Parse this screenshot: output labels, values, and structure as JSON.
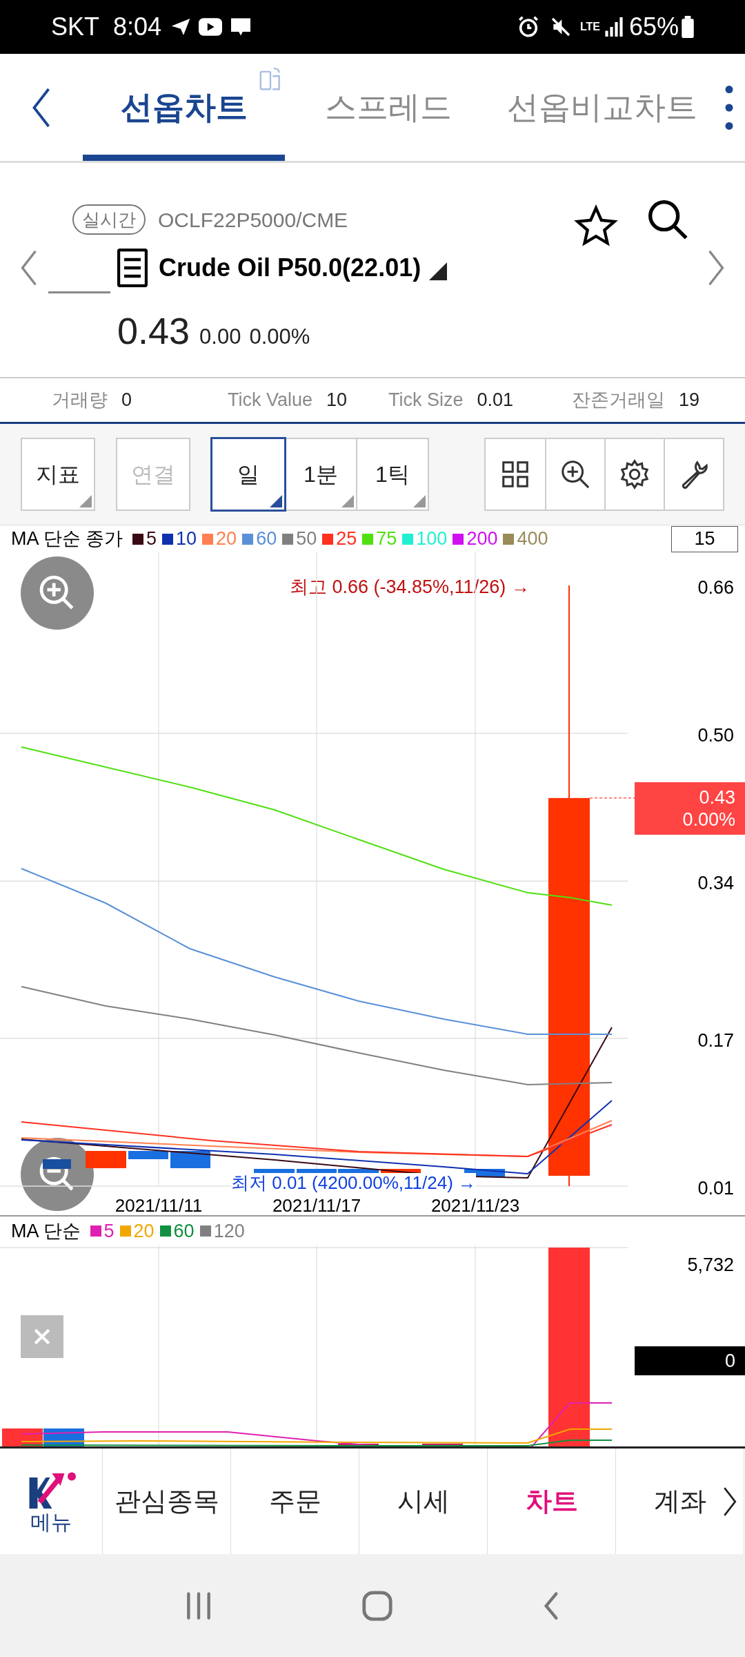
{
  "status_bar": {
    "carrier": "SKT",
    "time": "8:04",
    "network": "LTE",
    "battery": "65%"
  },
  "tabs": [
    {
      "label": "선옵차트",
      "selected": true
    },
    {
      "label": "스프레드",
      "selected": false
    },
    {
      "label": "선옵비교차트",
      "selected": false
    }
  ],
  "instrument": {
    "badge": "실시간",
    "code": "OCLF22P5000/CME",
    "name": "Crude Oil P50.0(22.01)",
    "price": "0.43",
    "change": "0.00",
    "change_pct": "0.00%"
  },
  "stats": [
    {
      "label": "거래량",
      "value": "0"
    },
    {
      "label": "Tick Value",
      "value": "10"
    },
    {
      "label": "Tick Size",
      "value": "0.01"
    },
    {
      "label": "잔존거래일",
      "value": "19"
    }
  ],
  "toolbar": [
    {
      "label": "지표",
      "selected": false,
      "disabled": false,
      "has_menu": true
    },
    {
      "label": "연결",
      "selected": false,
      "disabled": true,
      "has_menu": false
    },
    {
      "label": "일",
      "selected": true,
      "disabled": false,
      "has_menu": true
    },
    {
      "label": "1분",
      "selected": false,
      "disabled": false,
      "has_menu": true
    },
    {
      "label": "1틱",
      "selected": false,
      "disabled": false,
      "has_menu": true
    }
  ],
  "price_chart": {
    "legend_title": "MA 단순 종가",
    "legend": [
      {
        "label": "5",
        "color": "#3a0a14"
      },
      {
        "label": "10",
        "color": "#1030b0"
      },
      {
        "label": "20",
        "color": "#ff8050"
      },
      {
        "label": "60",
        "color": "#5a90d8"
      },
      {
        "label": "50",
        "color": "#808080"
      },
      {
        "label": "25",
        "color": "#ff3020"
      },
      {
        "label": "75",
        "color": "#50e010"
      },
      {
        "label": "100",
        "color": "#20f0d0"
      },
      {
        "label": "200",
        "color": "#d010f0"
      },
      {
        "label": "400",
        "color": "#9a8a5a"
      }
    ],
    "period": "15",
    "y_labels": [
      "0.66",
      "0.50",
      "0.34",
      "0.17",
      "0.01"
    ],
    "x_labels": [
      "2021/11/11",
      "2021/11/17",
      "2021/11/23"
    ],
    "high_note": "최고 0.66 (-34.85%,11/26) →",
    "low_note": "최저 0.01 (4200.00%,11/24) →",
    "current_price": "0.43",
    "current_change": "0.00%"
  },
  "volume_chart": {
    "legend_title": "MA 단순",
    "legend": [
      {
        "label": "5",
        "color": "#e020b0"
      },
      {
        "label": "20",
        "color": "#f0a800"
      },
      {
        "label": "60",
        "color": "#109040"
      },
      {
        "label": "120",
        "color": "#808080"
      }
    ],
    "y_labels": [
      "5,732"
    ],
    "current_value": "0"
  },
  "bottom_nav": {
    "menu_label": "메뉴",
    "items": [
      {
        "label": "관심종목",
        "selected": false
      },
      {
        "label": "주문",
        "selected": false
      },
      {
        "label": "시세",
        "selected": false
      },
      {
        "label": "차트",
        "selected": true
      },
      {
        "label": "계좌",
        "selected": false
      }
    ]
  }
}
